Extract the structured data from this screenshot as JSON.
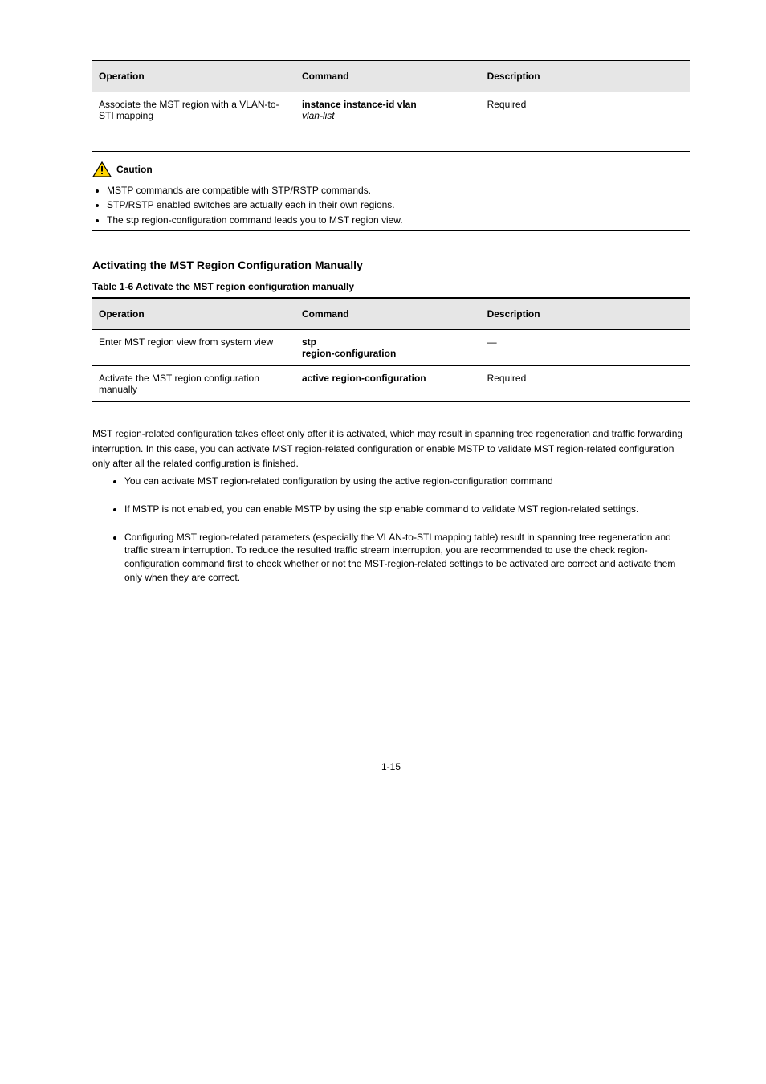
{
  "table1": {
    "headers": [
      "Operation",
      "Command",
      "Description"
    ],
    "row": {
      "op": "Associate the MST region with a VLAN-to-STI mapping",
      "cmd_l1": "instance instance-id vlan",
      "cmd_l2": "vlan-list",
      "desc": "Required"
    }
  },
  "caution": {
    "label": "Caution",
    "items": [
      "MSTP commands are compatible with STP/RSTP commands.",
      "STP/RSTP enabled switches are actually each in their own regions.",
      "The stp region-configuration command leads you to MST region view."
    ]
  },
  "section_heading": "Activating the MST Region Configuration Manually",
  "table2": {
    "caption": "Table 1-6 Activate the MST region configuration manually",
    "headers": [
      "Operation",
      "Command",
      "Description"
    ],
    "rows": [
      {
        "op": "Enter MST region view from system view",
        "cmd_l1": "stp",
        "cmd_l2": "region-configuration",
        "desc": "—"
      },
      {
        "op": "Activate the MST region configuration manually",
        "cmd": "active region-configuration",
        "desc": "Required"
      }
    ]
  },
  "body": {
    "intro": "MST region-related configuration takes effect only after it is activated, which may result in spanning tree regeneration and traffic forwarding interruption. In this case, you can activate MST region-related configuration or enable MSTP to validate MST region-related configuration only after all the related configuration is finished.",
    "items": [
      "You can activate MST region-related configuration by using the active region-configuration command",
      "If MSTP is not enabled, you can enable MSTP by using the stp enable command to validate MST region-related settings.",
      "Configuring MST region-related parameters (especially the VLAN-to-STI mapping table) result in spanning tree regeneration and traffic stream interruption. To reduce the resulted traffic stream interruption, you are recommended to use the check region-configuration command first to check whether or not the MST-region-related settings to be activated are correct and activate them only when they are correct."
    ]
  },
  "page_number": "1-15"
}
